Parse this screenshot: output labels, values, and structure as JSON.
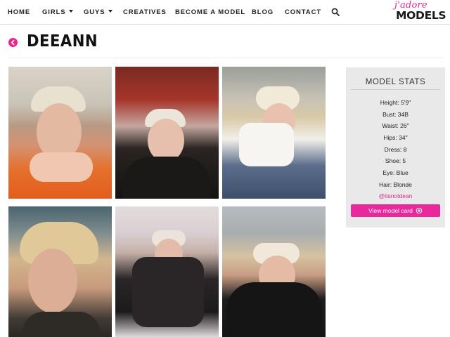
{
  "nav": {
    "items": [
      {
        "label": "HOME",
        "dropdown": false
      },
      {
        "label": "GIRLS",
        "dropdown": true
      },
      {
        "label": "GUYS",
        "dropdown": true
      },
      {
        "label": "CREATIVES",
        "dropdown": false
      },
      {
        "label": "BECOME A MODEL",
        "dropdown": false
      },
      {
        "label": "BLOG",
        "dropdown": false
      },
      {
        "label": "CONTACT",
        "dropdown": false
      }
    ],
    "search_icon": "search-icon"
  },
  "logo": {
    "top": "j'adore",
    "bottom": "MODELS"
  },
  "page": {
    "title": "DEEANN",
    "back_icon": "chevron-left-circle-icon"
  },
  "photos": [
    {
      "name": "photo-1"
    },
    {
      "name": "photo-2"
    },
    {
      "name": "photo-3"
    },
    {
      "name": "photo-4"
    },
    {
      "name": "photo-5"
    },
    {
      "name": "photo-6"
    }
  ],
  "stats": {
    "title": "MODEL STATS",
    "items": [
      "Height: 5'9\"",
      "Bust: 34B",
      "Waist: 26\"",
      "Hips: 34\"",
      "Dress: 8",
      "Shoe: 5",
      "Eye: Blue",
      "Hair: Blonde"
    ],
    "handle": "@itsnotdean",
    "button_label": "View model card",
    "button_icon": "eye-icon"
  },
  "colors": {
    "accent": "#e6288e",
    "button": "#e9289b",
    "panel": "#e9e9e9"
  }
}
